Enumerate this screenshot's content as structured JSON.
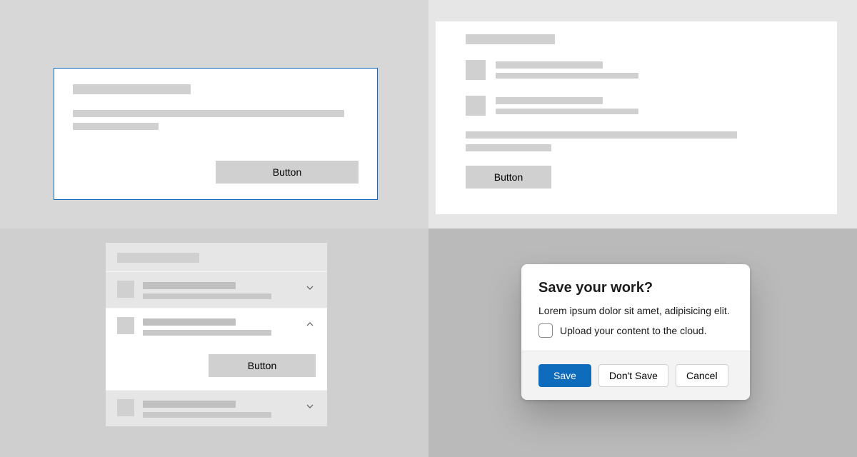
{
  "card1": {
    "button_label": "Button"
  },
  "card2": {
    "button_label": "Button"
  },
  "accordion": {
    "items": [
      {
        "expanded": false
      },
      {
        "expanded": true,
        "button_label": "Button"
      },
      {
        "expanded": false
      }
    ]
  },
  "dialog": {
    "title": "Save your work?",
    "body": "Lorem ipsum dolor sit amet, adipisicing elit.",
    "checkbox_label": "Upload your content to the cloud.",
    "primary_label": "Save",
    "secondary_label": "Don't Save",
    "cancel_label": "Cancel"
  }
}
